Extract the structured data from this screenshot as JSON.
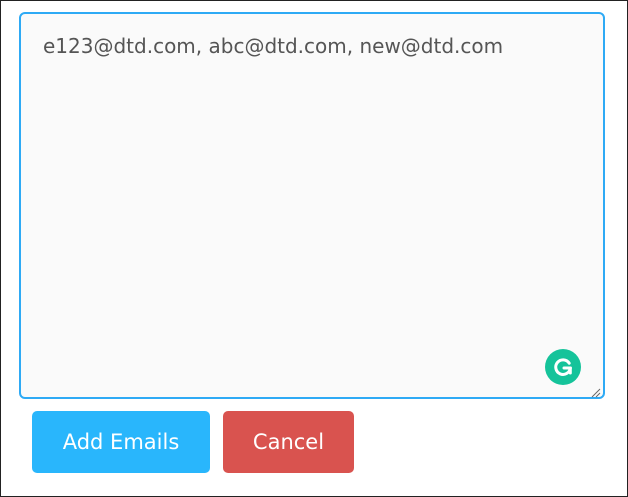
{
  "email_input": {
    "value": "e123@dtd.com, abc@dtd.com, new@dtd.com"
  },
  "actions": {
    "add_label": "Add Emails",
    "cancel_label": "Cancel"
  },
  "icons": {
    "grammarly": "grammarly-icon",
    "resize": "resize-handle-icon"
  },
  "colors": {
    "focus_border": "#2eaaf5",
    "add_button": "#29b6fc",
    "cancel_button": "#d9534f",
    "grammarly": "#15c39a"
  }
}
